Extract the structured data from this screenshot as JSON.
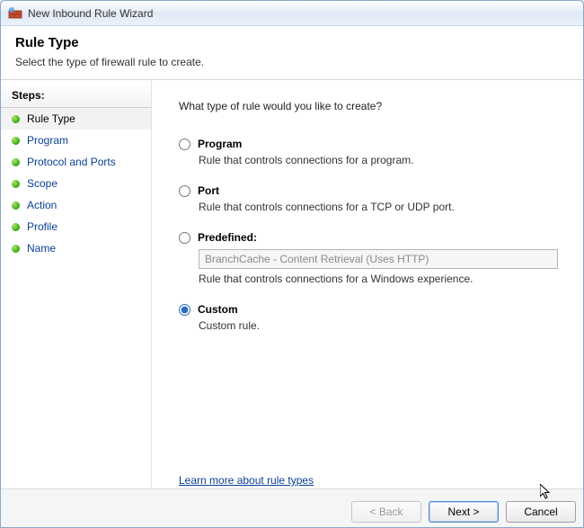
{
  "window": {
    "title": "New Inbound Rule Wizard"
  },
  "header": {
    "heading": "Rule Type",
    "subtitle": "Select the type of firewall rule to create."
  },
  "sidebar": {
    "heading": "Steps:",
    "items": [
      {
        "label": "Rule Type",
        "active": true
      },
      {
        "label": "Program",
        "active": false
      },
      {
        "label": "Protocol and Ports",
        "active": false
      },
      {
        "label": "Scope",
        "active": false
      },
      {
        "label": "Action",
        "active": false
      },
      {
        "label": "Profile",
        "active": false
      },
      {
        "label": "Name",
        "active": false
      }
    ]
  },
  "content": {
    "question": "What type of rule would you like to create?",
    "options": {
      "program": {
        "label": "Program",
        "desc": "Rule that controls connections for a program."
      },
      "port": {
        "label": "Port",
        "desc": "Rule that controls connections for a TCP or UDP port."
      },
      "predefined": {
        "label": "Predefined:",
        "selected_value": "BranchCache - Content Retrieval (Uses HTTP)",
        "desc": "Rule that controls connections for a Windows experience."
      },
      "custom": {
        "label": "Custom",
        "desc": "Custom rule."
      }
    },
    "selected": "custom",
    "learn_link": "Learn more about rule types"
  },
  "buttons": {
    "back": "< Back",
    "next": "Next >",
    "cancel": "Cancel"
  }
}
